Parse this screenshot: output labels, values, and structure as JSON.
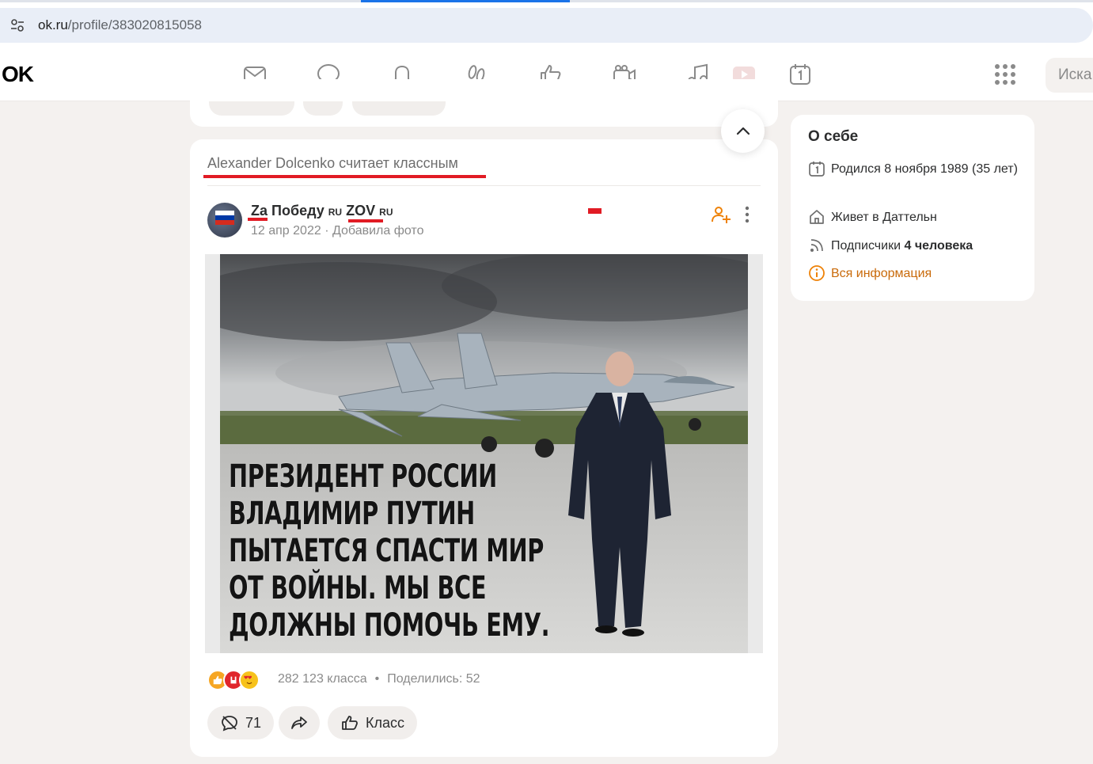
{
  "browser": {
    "url_domain": "ok.ru",
    "url_path": "/profile/383020815058"
  },
  "header": {
    "logo": "OK",
    "nav_icons": [
      "mail-icon",
      "chat-icon",
      "bell-icon",
      "guests-icon",
      "like-icon",
      "video-camera-icon",
      "music-icon",
      "video-icon",
      "calendar-icon"
    ],
    "apps_icon": "apps-grid-icon",
    "search_placeholder": "Иска"
  },
  "post": {
    "liked_by": "Alexander Dolcenko считает классным",
    "author_prefix": "Za",
    "author_name": "Победу",
    "author_tag1": "RU",
    "author_mid": "ZOV",
    "author_tag2": "RU",
    "date": "12 апр 2022",
    "separator": "·",
    "action": "Добавила фото",
    "image_lines": [
      "ПРЕЗИДЕНТ РОССИИ",
      "ВЛАДИМИР ПУТИН",
      "ПЫТАЕТСЯ СПАСТИ МИР",
      "ОТ ВОЙНЫ. МЫ ВСЕ",
      "ДОЛЖНЫ ПОМОЧЬ ЕМУ."
    ],
    "class_count": "282 123 класса",
    "dot": "•",
    "shared": "Поделились: 52",
    "comments_count": "71",
    "class_button": "Класс"
  },
  "about": {
    "title": "О себе",
    "birth": "Родился 8 ноября 1989 (35 лет)",
    "lives": "Живет в Даттельн",
    "subscribers_label": "Подписчики",
    "subscribers_value": "4 человека",
    "all_info": "Вся информация"
  },
  "colors": {
    "accent": "#ee8208",
    "link": "#c96a0a",
    "annotation_red": "#e11b24",
    "background": "#f4f1ef"
  }
}
